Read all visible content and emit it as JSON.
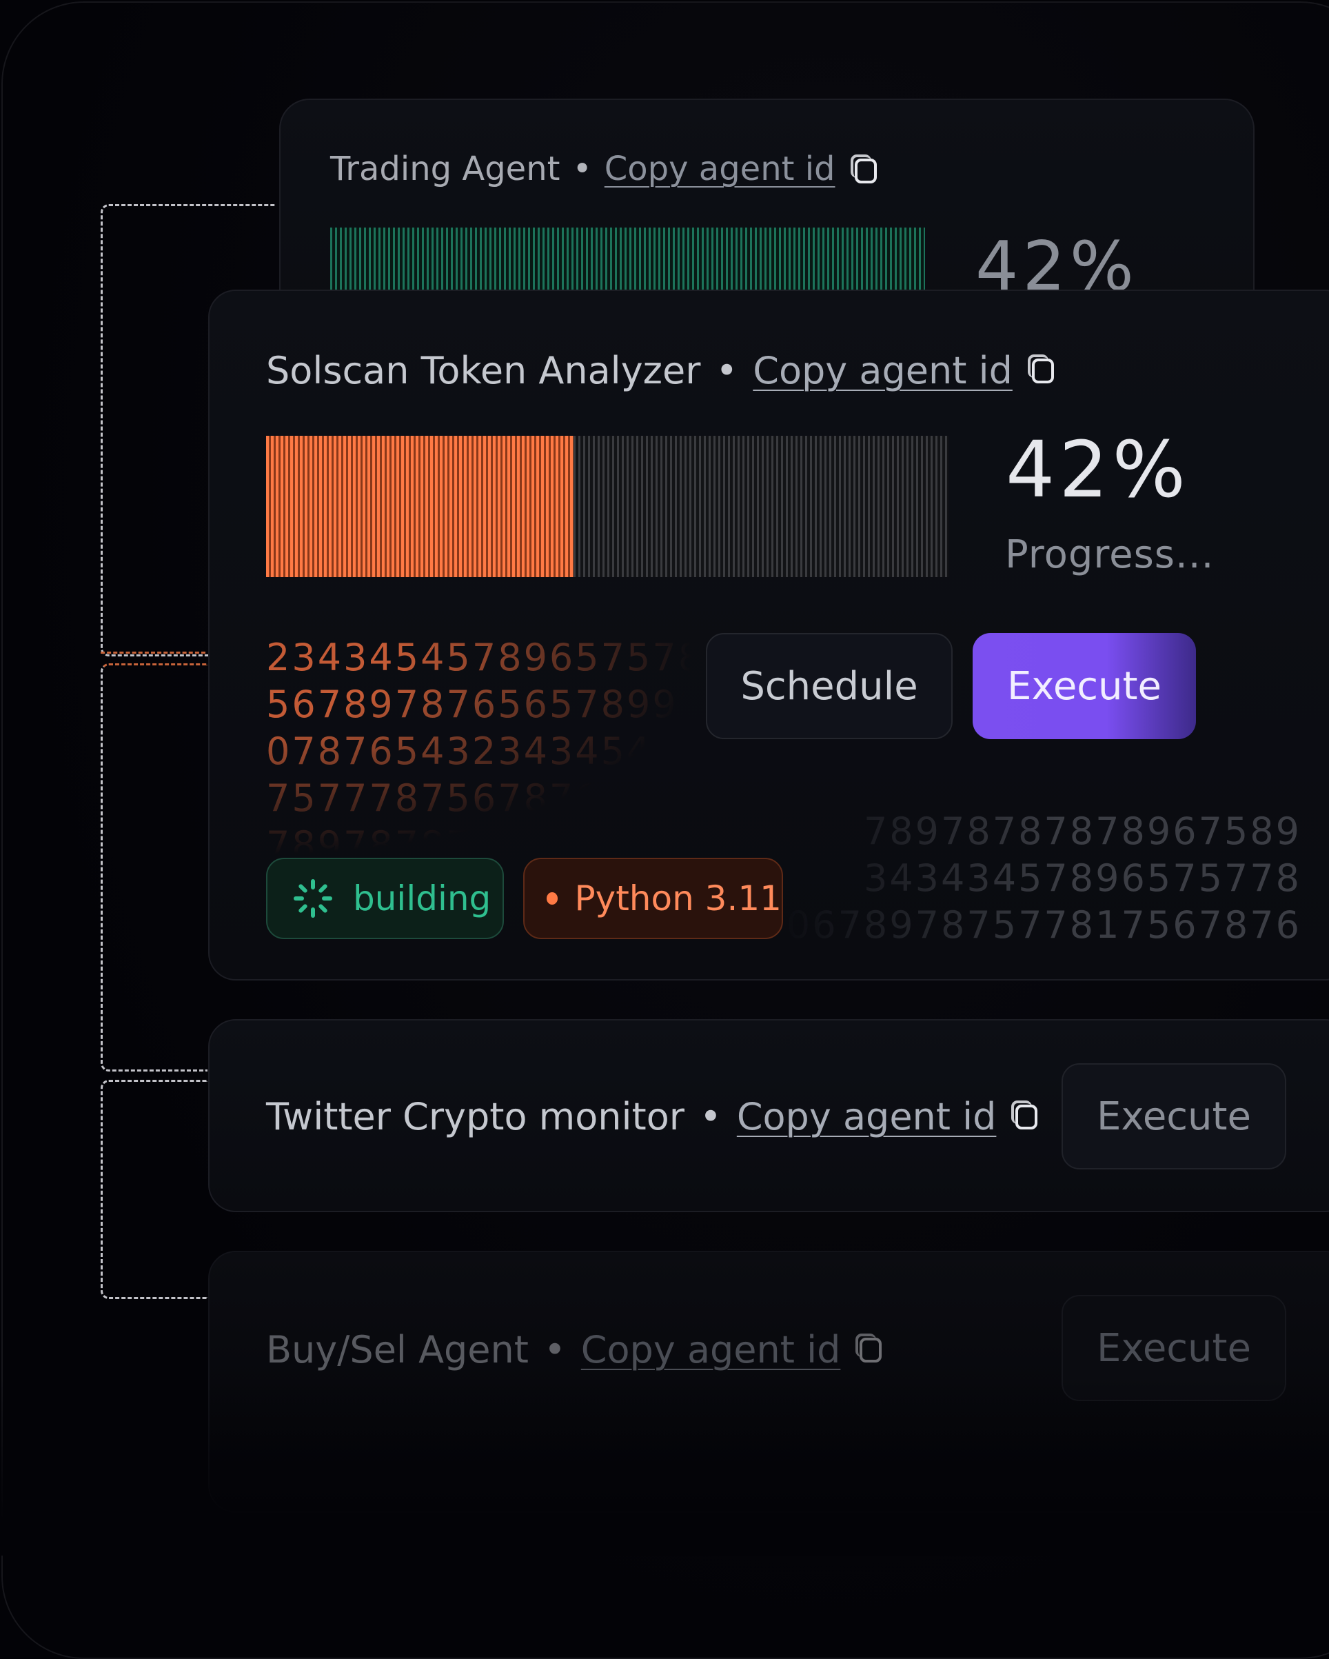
{
  "agents": {
    "trading": {
      "name": "Trading Agent",
      "separator": "•",
      "copy_label": "Copy agent id",
      "progress_percent_text": "42%",
      "progress": 0.42
    },
    "solscan": {
      "name": "Solscan Token Analyzer",
      "separator": "•",
      "copy_label": "Copy agent id",
      "progress_percent_text": "42%",
      "progress_label": "Progress...",
      "progress": 0.45,
      "numbers_left": [
        "23434545789657578343",
        "56789787656578990878",
        "07876543234345454545",
        "75777875678767677",
        "78978787"
      ],
      "numbers_right": [
        "78978787878967589",
        "34343457896575778",
        "06789787577817567876"
      ],
      "schedule_label": "Schedule",
      "execute_label": "Execute",
      "status_badge": "building",
      "runtime_badge": "Python 3.11"
    },
    "twitter": {
      "name": "Twitter Crypto monitor",
      "separator": "•",
      "copy_label": "Copy agent id",
      "execute_label": "Execute"
    },
    "buysell": {
      "name": "Buy/Sel Agent",
      "separator": "•",
      "copy_label": "Copy agent id",
      "execute_label": "Execute"
    }
  },
  "colors": {
    "accent_purple": "#7b4ff0",
    "progress_orange": "#ff7a45",
    "status_green": "#2fbf8f",
    "runtime_orange": "#ff8a5b",
    "trading_green": "#1f8567"
  },
  "icons": {
    "copy": "copy-icon",
    "spinner": "spinner-icon",
    "dot": "dot-icon"
  }
}
